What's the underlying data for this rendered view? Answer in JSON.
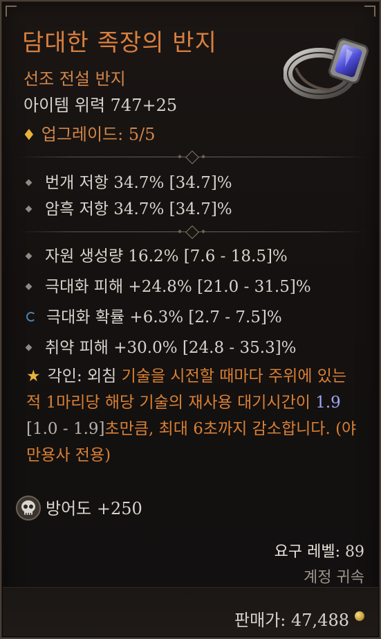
{
  "item": {
    "name": "담대한 족장의 반지",
    "rarity": "선조 전설 반지",
    "power": "아이템 위력 747+25",
    "upgrade": "업그레이드: 5/5"
  },
  "stats_top": [
    {
      "text": "번개 저항 34.7% [34.7]%"
    },
    {
      "text": "암흑 저항 34.7% [34.7]%"
    }
  ],
  "stats_main": [
    {
      "text": "자원 생성량 16.2% [7.6 - 18.5]%"
    },
    {
      "text": "극대화 피해 +24.8% [21.0 - 31.5]%"
    },
    {
      "text": "극대화 확률 +6.3% [2.7 - 7.5]%"
    },
    {
      "text": "취약 피해 +30.0% [24.8 - 35.3]%"
    }
  ],
  "aspect": {
    "label": "각인: 외침",
    "part1": " 기술을 시전할 때마다 주위에 있는 적 1마리당 해당 기술의 재사용 대기시간이 ",
    "value": "1.9",
    "range": " [1.0 - 1.9]",
    "part2": "초만큼, 최대 6초까지 감소합니다. (야만용사 전용)"
  },
  "armor": "방어도 +250",
  "requirement": {
    "label": "요구 레벨:",
    "value": "89"
  },
  "bound": "계정 귀속",
  "sell": {
    "label": "판매가:",
    "value": "47,488"
  },
  "icons": [
    "diamond-icon",
    "bullet-icon",
    "swirl-icon",
    "star-icon",
    "skull-icon",
    "gold-coin-icon",
    "ring-image"
  ],
  "colors": {
    "legendary": "#d97f3e",
    "text": "#d8d3cc",
    "blue_value": "#9fa7f2",
    "gold": "#e7b43a"
  }
}
